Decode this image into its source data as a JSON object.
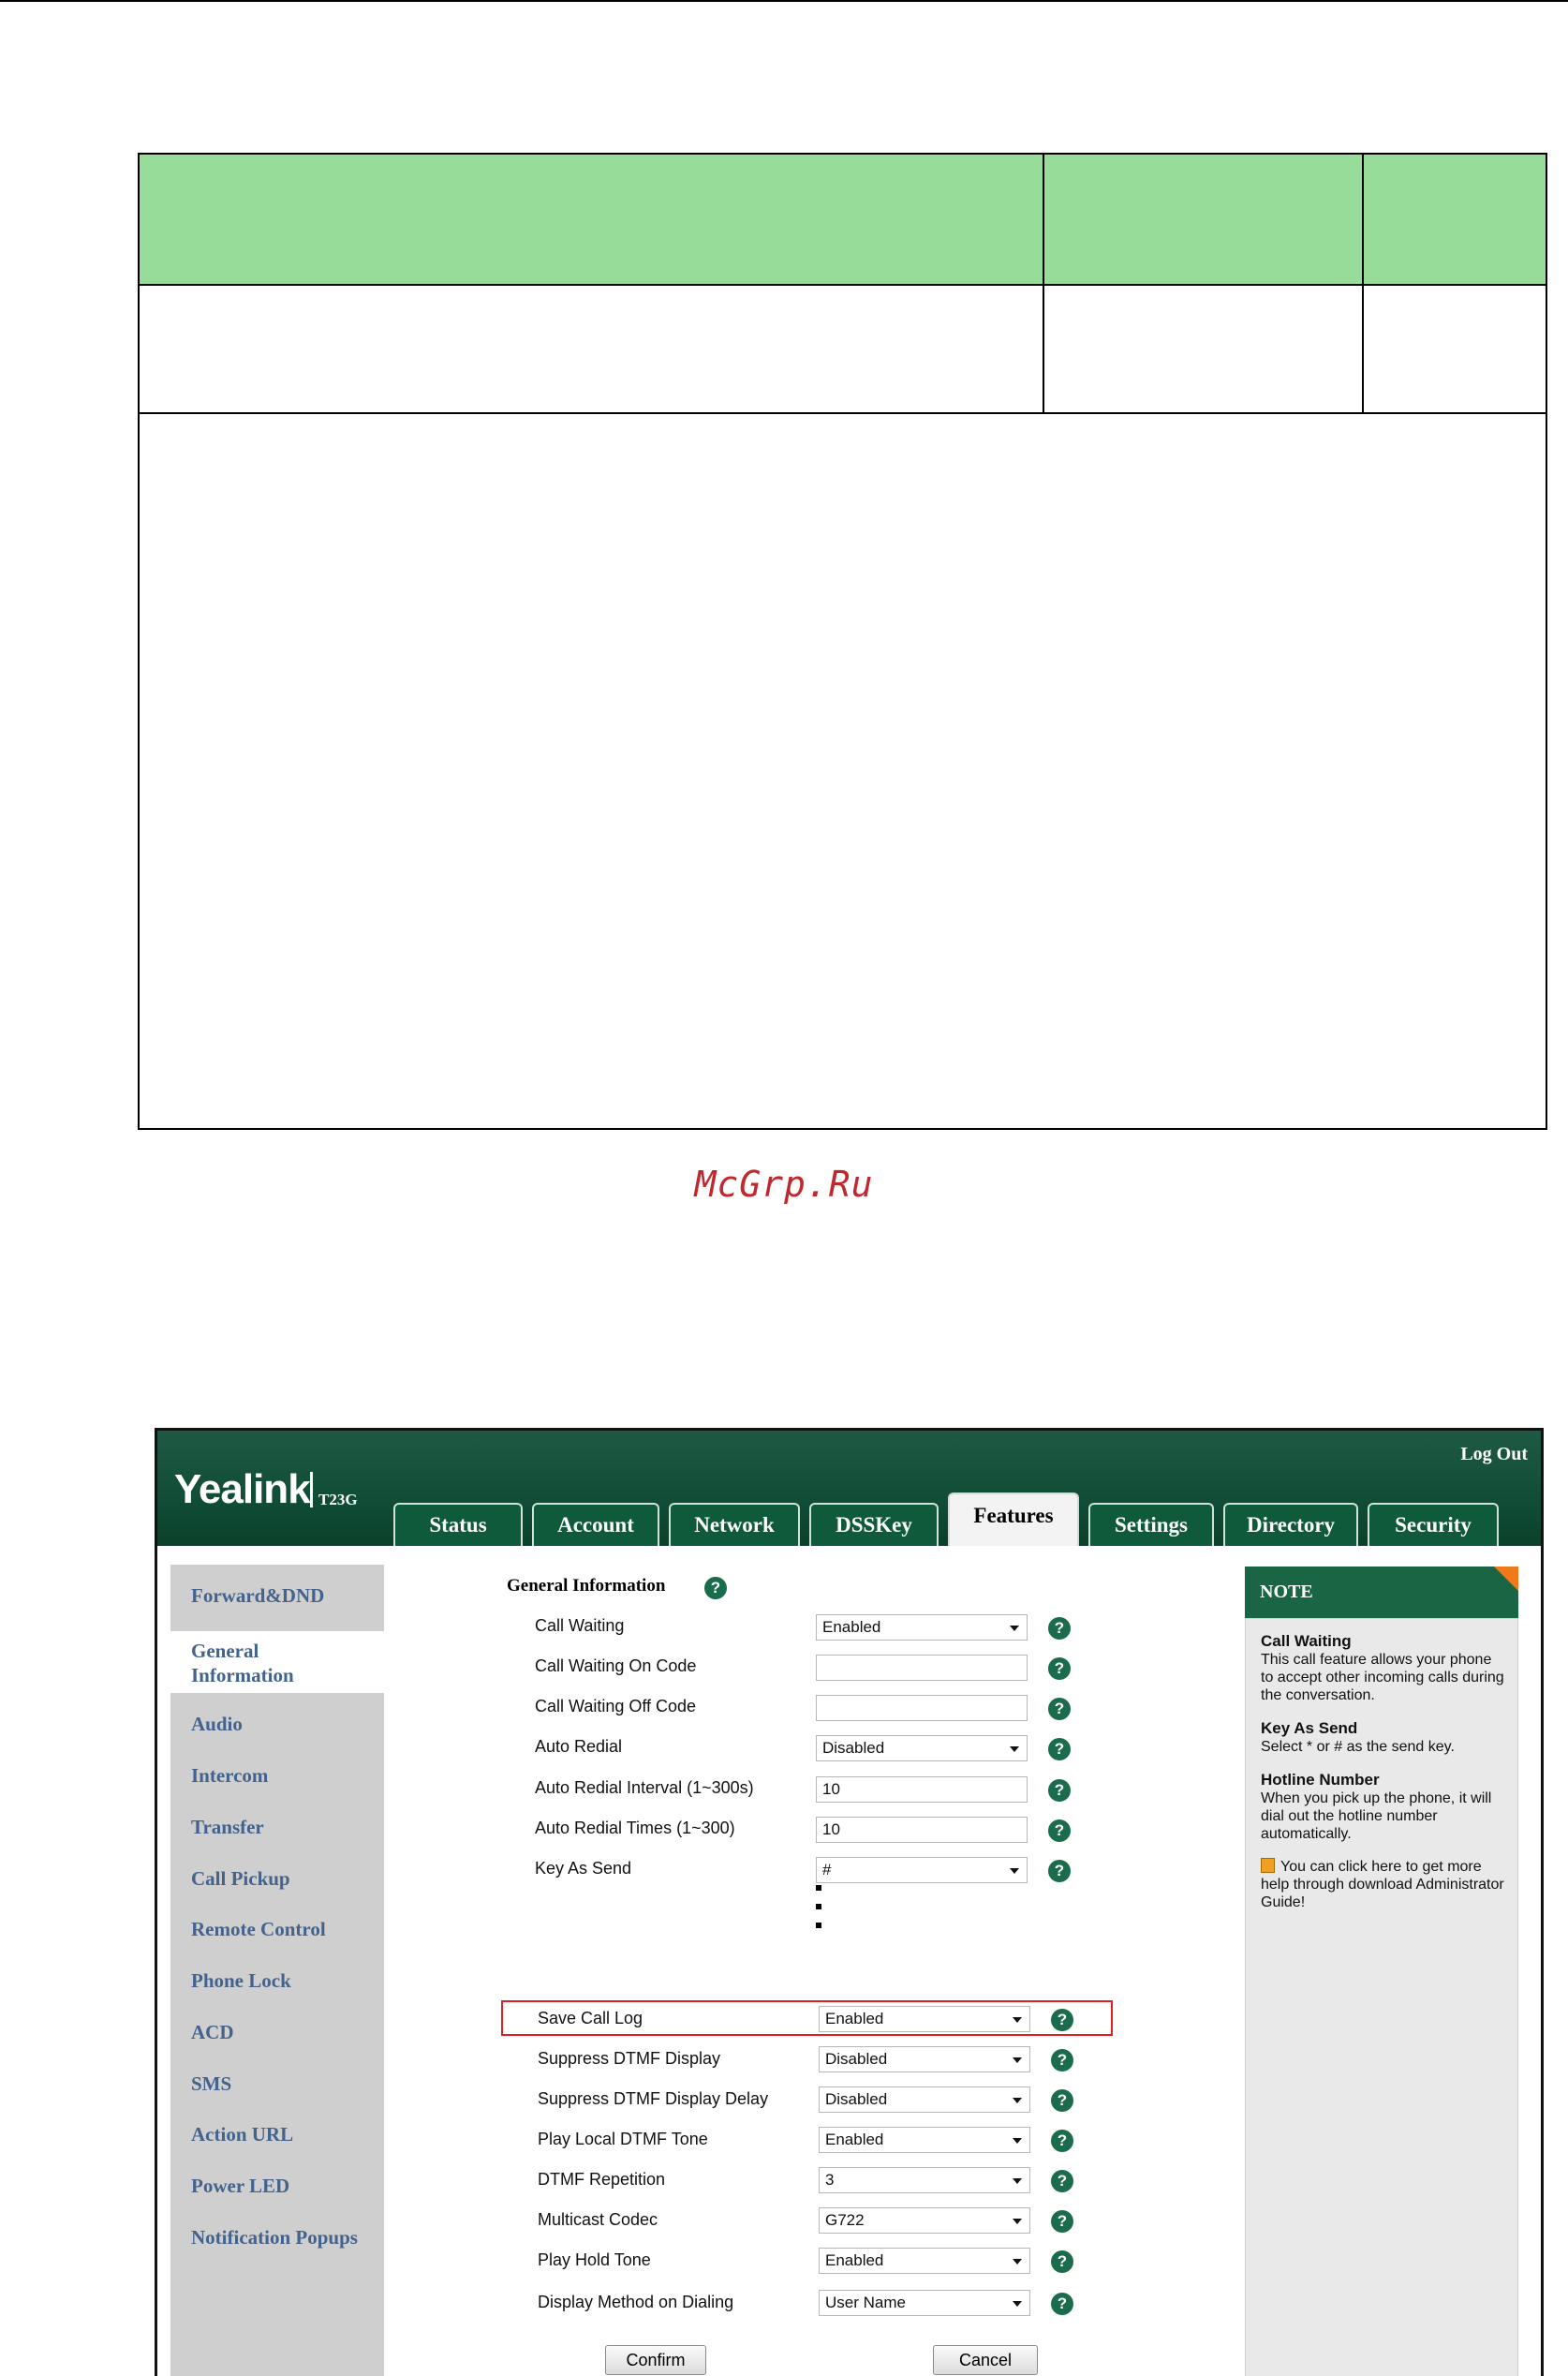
{
  "watermark": "McGrp.Ru",
  "app": {
    "brand": "Yealink",
    "model": "T23G",
    "logout": "Log Out",
    "tabs": [
      "Status",
      "Account",
      "Network",
      "DSSKey",
      "Features",
      "Settings",
      "Directory",
      "Security"
    ],
    "active_tab": "Features"
  },
  "sidebar": {
    "items": [
      "Forward&DND",
      "General Information",
      "Audio",
      "Intercom",
      "Transfer",
      "Call Pickup",
      "Remote Control",
      "Phone Lock",
      "ACD",
      "SMS",
      "Action URL",
      "Power LED",
      "Notification Popups"
    ],
    "active": "General Information",
    "general_line1": "General",
    "general_line2": "Information"
  },
  "form": {
    "section_title": "General Information",
    "help_glyph": "?",
    "rows_top": [
      {
        "label": "Call Waiting",
        "value": "Enabled",
        "type": "select"
      },
      {
        "label": "Call Waiting On Code",
        "value": "",
        "type": "text"
      },
      {
        "label": "Call Waiting Off Code",
        "value": "",
        "type": "text"
      },
      {
        "label": "Auto Redial",
        "value": "Disabled",
        "type": "select"
      },
      {
        "label": "Auto Redial Interval (1~300s)",
        "value": "10",
        "type": "text"
      },
      {
        "label": "Auto Redial Times (1~300)",
        "value": "10",
        "type": "text"
      },
      {
        "label": "Key As Send",
        "value": "#",
        "type": "select"
      }
    ],
    "rows_bottom": [
      {
        "label": "Save Call Log",
        "value": "Enabled",
        "type": "select",
        "highlighted": true
      },
      {
        "label": "Suppress DTMF Display",
        "value": "Disabled",
        "type": "select"
      },
      {
        "label": "Suppress DTMF Display Delay",
        "value": "Disabled",
        "type": "select"
      },
      {
        "label": "Play Local DTMF Tone",
        "value": "Enabled",
        "type": "select"
      },
      {
        "label": "DTMF Repetition",
        "value": "3",
        "type": "select"
      },
      {
        "label": "Multicast Codec",
        "value": "G722",
        "type": "select"
      },
      {
        "label": "Play Hold Tone",
        "value": "Enabled",
        "type": "select"
      },
      {
        "label": "Display Method on Dialing",
        "value": "User Name",
        "type": "select"
      }
    ],
    "confirm": "Confirm",
    "cancel": "Cancel"
  },
  "note": {
    "title": "NOTE",
    "sections": [
      {
        "heading": "Call Waiting",
        "text": "This call feature allows your phone to accept other incoming calls during the conversation."
      },
      {
        "heading": "Key As Send",
        "text": "Select * or # as the send key."
      },
      {
        "heading": "Hotline Number",
        "text": "When you pick up the phone, it will dial out the hotline number automatically."
      }
    ],
    "help_text": "You can click here to get more help through download Administrator Guide!"
  },
  "colors": {
    "header_green": "#98dc9a",
    "banner_green": "#0f4a34",
    "sidebar_link": "#43628c",
    "highlight_red": "#e02020",
    "note_corner": "#f07a1a",
    "watermark_red": "#c0282d"
  }
}
